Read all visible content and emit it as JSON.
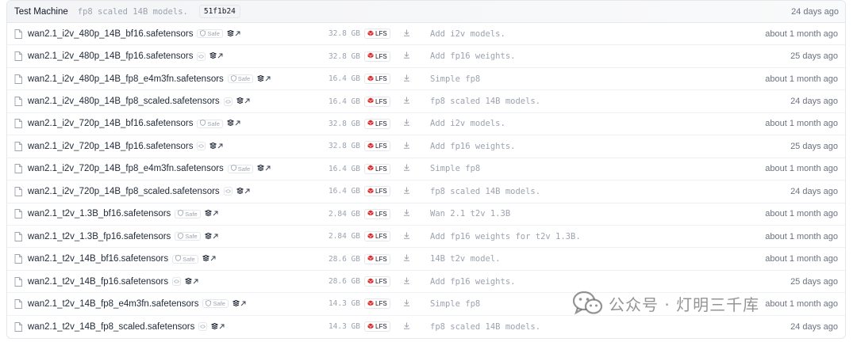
{
  "commit": {
    "author": "Test Machine",
    "message": "fp8 scaled 14B models.",
    "hash": "51f1b24",
    "date": "24 days ago"
  },
  "labels": {
    "safe": "Safe",
    "lfs": "LFS"
  },
  "watermark": "公众号 · 灯明三千库",
  "files": [
    {
      "name": "wan2.1_i2v_480p_14B_bf16.safetensors",
      "safe": true,
      "size": "32.8 GB",
      "message": "Add i2v models.",
      "date": "about 1 month ago"
    },
    {
      "name": "wan2.1_i2v_480p_14B_fp16.safetensors",
      "safe": false,
      "size": "32.8 GB",
      "message": "Add fp16 weights.",
      "date": "25 days ago"
    },
    {
      "name": "wan2.1_i2v_480p_14B_fp8_e4m3fn.safetensors",
      "safe": true,
      "size": "16.4 GB",
      "message": "Simple fp8",
      "date": "about 1 month ago"
    },
    {
      "name": "wan2.1_i2v_480p_14B_fp8_scaled.safetensors",
      "safe": false,
      "size": "16.4 GB",
      "message": "fp8 scaled 14B models.",
      "date": "24 days ago"
    },
    {
      "name": "wan2.1_i2v_720p_14B_bf16.safetensors",
      "safe": true,
      "size": "32.8 GB",
      "message": "Add i2v models.",
      "date": "about 1 month ago"
    },
    {
      "name": "wan2.1_i2v_720p_14B_fp16.safetensors",
      "safe": false,
      "size": "32.8 GB",
      "message": "Add fp16 weights.",
      "date": "25 days ago"
    },
    {
      "name": "wan2.1_i2v_720p_14B_fp8_e4m3fn.safetensors",
      "safe": true,
      "size": "16.4 GB",
      "message": "Simple fp8",
      "date": "about 1 month ago"
    },
    {
      "name": "wan2.1_i2v_720p_14B_fp8_scaled.safetensors",
      "safe": false,
      "size": "16.4 GB",
      "message": "fp8 scaled 14B models.",
      "date": "24 days ago"
    },
    {
      "name": "wan2.1_t2v_1.3B_bf16.safetensors",
      "safe": true,
      "size": "2.84 GB",
      "message": "Wan 2.1 t2v 1.3B",
      "date": "about 1 month ago"
    },
    {
      "name": "wan2.1_t2v_1.3B_fp16.safetensors",
      "safe": true,
      "size": "2.84 GB",
      "message": "Add fp16 weights for t2v 1.3B.",
      "date": "about 1 month ago"
    },
    {
      "name": "wan2.1_t2v_14B_bf16.safetensors",
      "safe": true,
      "size": "28.6 GB",
      "message": "14B t2v model.",
      "date": "about 1 month ago"
    },
    {
      "name": "wan2.1_t2v_14B_fp16.safetensors",
      "safe": false,
      "size": "28.6 GB",
      "message": "Add fp16 weights.",
      "date": "25 days ago"
    },
    {
      "name": "wan2.1_t2v_14B_fp8_e4m3fn.safetensors",
      "safe": true,
      "size": "14.3 GB",
      "message": "Simple fp8",
      "date": "about 1 month ago"
    },
    {
      "name": "wan2.1_t2v_14B_fp8_scaled.safetensors",
      "safe": false,
      "size": "14.3 GB",
      "message": "fp8 scaled 14B models.",
      "date": "24 days ago"
    }
  ]
}
